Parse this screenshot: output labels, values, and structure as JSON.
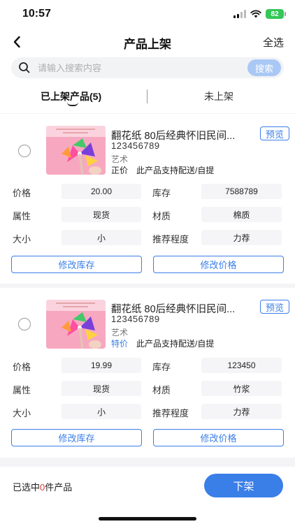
{
  "status_bar": {
    "time": "10:57",
    "battery": "82"
  },
  "nav": {
    "title": "产品上架",
    "select_all": "全选"
  },
  "search": {
    "placeholder": "请输入搜索内容",
    "button": "搜索"
  },
  "tabs": {
    "listed_label": "已上架产品",
    "listed_count": "(5)",
    "unlisted_label": "未上架"
  },
  "products": [
    {
      "name": "翻花纸 80后经典怀旧民间...",
      "preview": "预览",
      "code": "123456789",
      "category": "艺术",
      "price_type": "正价",
      "price_type_color": "#222222",
      "delivery": "此产品支持配送/自提",
      "attrs": {
        "price_label": "价格",
        "price": "20.00",
        "stock_label": "库存",
        "stock": "7588789",
        "property_label": "属性",
        "property": "现货",
        "material_label": "材质",
        "material": "棉质",
        "size_label": "大小",
        "size": "小",
        "recommend_label": "推荐程度",
        "recommend": "力荐"
      },
      "edit_stock": "修改库存",
      "edit_price": "修改价格"
    },
    {
      "name": "翻花纸 80后经典怀旧民间...",
      "preview": "预览",
      "code": "123456789",
      "category": "艺术",
      "price_type": "特价",
      "price_type_color": "#3a7ee8",
      "delivery": "此产品支持配送/自提",
      "attrs": {
        "price_label": "价格",
        "price": "19.99",
        "stock_label": "库存",
        "stock": "123450",
        "property_label": "属性",
        "property": "现货",
        "material_label": "材质",
        "material": "竹浆",
        "size_label": "大小",
        "size": "小",
        "recommend_label": "推荐程度",
        "recommend": "力荐"
      },
      "edit_stock": "修改库存",
      "edit_price": "修改价格"
    }
  ],
  "bottom": {
    "selected_prefix": "已选中",
    "selected_count": "0",
    "selected_suffix": "件产品",
    "delist_button": "下架"
  },
  "colors": {
    "accent": "#3a7ee8",
    "count_red": "#e53935"
  }
}
